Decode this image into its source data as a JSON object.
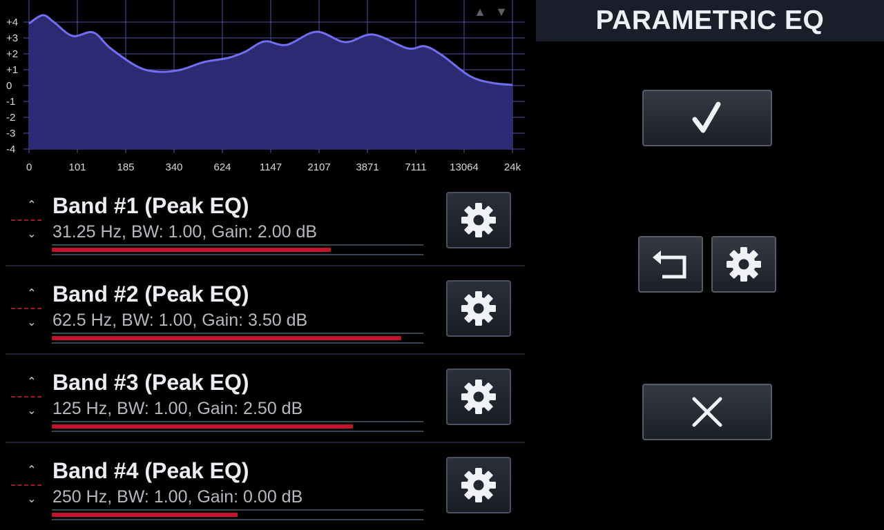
{
  "graph": {
    "y_tick_labels": [
      "+4",
      "+3",
      "+2",
      "+1",
      "0",
      "-1",
      "-2",
      "-3",
      "-4"
    ],
    "x_tick_labels": [
      "0",
      "101",
      "185",
      "340",
      "624",
      "1147",
      "2107",
      "3871",
      "7111",
      "13064",
      "24k"
    ],
    "scroll_up_icon": "triangle-up-icon",
    "scroll_down_icon": "triangle-down-icon",
    "colors": {
      "fill": "#2e2c78",
      "line": "#6f6ff0",
      "grid": "#4f4fa8"
    }
  },
  "bands": [
    {
      "title": "Band #1 (Peak EQ)",
      "details": "31.25 Hz, BW: 1.00, Gain: 2.00 dB",
      "level": 0.75
    },
    {
      "title": "Band #2 (Peak EQ)",
      "details": "62.5 Hz, BW: 1.00, Gain: 3.50 dB",
      "level": 0.94
    },
    {
      "title": "Band #3 (Peak EQ)",
      "details": "125 Hz, BW: 1.00, Gain: 2.50 dB",
      "level": 0.81
    },
    {
      "title": "Band #4 (Peak EQ)",
      "details": "250 Hz, BW: 1.00, Gain: 0.00 dB",
      "level": 0.5
    }
  ],
  "panel": {
    "title": "PARAMETRIC EQ",
    "confirm_icon": "checkmark-icon",
    "reset_icon": "undo-icon",
    "settings_icon": "gear-icon",
    "cancel_icon": "close-icon"
  },
  "colors": {
    "accent": "#c0172c",
    "background": "#000000",
    "header": "#1a1d2a"
  }
}
